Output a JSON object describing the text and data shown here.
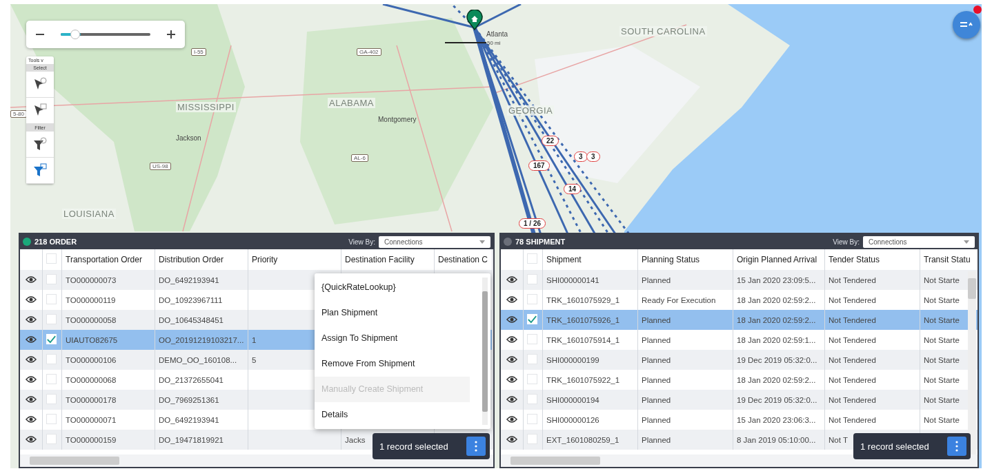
{
  "map": {
    "labels": [
      {
        "kind": "state",
        "text": "MISSISSIPPI"
      },
      {
        "kind": "state",
        "text": "ALABAMA"
      },
      {
        "kind": "state",
        "text": "GEORGIA"
      },
      {
        "kind": "state",
        "text": "SOUTH CAROLINA"
      },
      {
        "kind": "state",
        "text": "LOUISIANA"
      },
      {
        "kind": "city",
        "text": "Jackson"
      },
      {
        "kind": "city",
        "text": "Montgomery"
      },
      {
        "kind": "city",
        "text": "Atlanta"
      },
      {
        "kind": "road",
        "text": "I-55"
      },
      {
        "kind": "road",
        "text": "GA-402"
      },
      {
        "kind": "road",
        "text": "US-98"
      },
      {
        "kind": "road",
        "text": "AL-6"
      },
      {
        "kind": "road",
        "text": "5-80"
      },
      {
        "kind": "scale",
        "text": "50 mi"
      }
    ],
    "clusters": [
      "22",
      "167",
      "3",
      "3",
      "14",
      "1 / 26"
    ]
  },
  "zoom": {
    "level": 0.2
  },
  "tools": {
    "title": "Tools v",
    "sections": [
      {
        "label": "Select",
        "buttons": [
          {
            "kind": "select",
            "selected": false
          },
          {
            "kind": "select-area",
            "selected": false
          }
        ]
      },
      {
        "label": "Filter",
        "buttons": [
          {
            "kind": "filter",
            "selected": false
          },
          {
            "kind": "filter-area",
            "selected": true
          }
        ]
      }
    ]
  },
  "panels": [
    {
      "title": "218 ORDER",
      "color": "#1aa87a",
      "select_all_checked": false,
      "view_by_label": "View By:",
      "view_by": "Connections",
      "columns": [
        "Transportation Order",
        "Distribution Order",
        "Priority",
        "Destination Facility",
        "Destination C"
      ],
      "rows": [
        {
          "selected": false,
          "checked": false,
          "cells": [
            "TO000000073",
            "DO_6492193941",
            null,
            null,
            null
          ]
        },
        {
          "selected": false,
          "checked": false,
          "cells": [
            "TO000000119",
            "DO_10923967111",
            null,
            null,
            null
          ]
        },
        {
          "selected": false,
          "checked": false,
          "cells": [
            "TO000000058",
            "DO_10645348451",
            null,
            null,
            null
          ]
        },
        {
          "selected": true,
          "checked": true,
          "cells": [
            "UIAUTO82675",
            "OO_20191219103217...",
            "1",
            null,
            null
          ]
        },
        {
          "selected": false,
          "checked": false,
          "cells": [
            "TO000000106",
            "DEMO_OO_160108...",
            "5",
            null,
            null
          ]
        },
        {
          "selected": false,
          "checked": false,
          "cells": [
            "TO000000068",
            "DO_21372655041",
            null,
            null,
            null
          ]
        },
        {
          "selected": false,
          "checked": false,
          "cells": [
            "TO000000178",
            "DO_7969251361",
            null,
            null,
            null
          ]
        },
        {
          "selected": false,
          "checked": false,
          "cells": [
            "TO000000071",
            "DO_6492193941",
            null,
            null,
            null
          ]
        },
        {
          "selected": false,
          "checked": false,
          "cells": [
            "TO000000159",
            "DO_19471819921",
            null,
            "Jacks",
            null
          ]
        }
      ],
      "menu": [
        {
          "label": "{QuickRateLookup}",
          "disabled": false
        },
        {
          "label": "Plan Shipment",
          "disabled": false
        },
        {
          "label": "Assign To Shipment",
          "disabled": false
        },
        {
          "label": "Remove From Shipment",
          "disabled": false
        },
        {
          "label": "Manually Create Shipment",
          "disabled": true
        },
        {
          "label": "Details",
          "disabled": false
        }
      ],
      "toast": "1 record selected"
    },
    {
      "title": "78 SHIPMENT",
      "color": "#6b6f7a",
      "select_all_checked": false,
      "view_by_label": "View By:",
      "view_by": "Connections",
      "columns": [
        "Shipment",
        "Planning Status",
        "Origin Planned Arrival",
        "Tender Status",
        "Transit Statu"
      ],
      "rows": [
        {
          "selected": false,
          "checked": false,
          "cells": [
            "SHI000000141",
            "Planned",
            "15 Jan 2020 23:09:5...",
            "Not Tendered",
            "Not Starte"
          ]
        },
        {
          "selected": false,
          "checked": false,
          "cells": [
            "TRK_1601075929_1",
            "Ready For Execution",
            "18 Jan 2020 02:59:2...",
            "Not Tendered",
            "Not Starte"
          ]
        },
        {
          "selected": true,
          "checked": true,
          "cells": [
            "TRK_1601075926_1",
            "Planned",
            "18 Jan 2020 02:59:2...",
            "Not Tendered",
            "Not Starte"
          ]
        },
        {
          "selected": false,
          "checked": false,
          "cells": [
            "TRK_1601075914_1",
            "Planned",
            "18 Jan 2020 02:59:1...",
            "Not Tendered",
            "Not Starte"
          ]
        },
        {
          "selected": false,
          "checked": false,
          "cells": [
            "SHI000000199",
            "Planned",
            "19 Dec 2019 05:32:0...",
            "Not Tendered",
            "Not Starte"
          ]
        },
        {
          "selected": false,
          "checked": false,
          "cells": [
            "TRK_1601075922_1",
            "Planned",
            "18 Jan 2020 02:59:2...",
            "Not Tendered",
            "Not Starte"
          ]
        },
        {
          "selected": false,
          "checked": false,
          "cells": [
            "SHI000000194",
            "Planned",
            "19 Dec 2019 05:32:0...",
            "Not Tendered",
            "Not Starte"
          ]
        },
        {
          "selected": false,
          "checked": false,
          "cells": [
            "SHI000000126",
            "Planned",
            "15 Jan 2020 23:06:3...",
            "Not Tendered",
            "Not Starte"
          ]
        },
        {
          "selected": false,
          "checked": false,
          "cells": [
            "EXT_1601080259_1",
            "Planned",
            "8 Jan 2019 05:10:00...",
            "Not T",
            null
          ]
        }
      ],
      "toast": "1 record selected"
    }
  ]
}
